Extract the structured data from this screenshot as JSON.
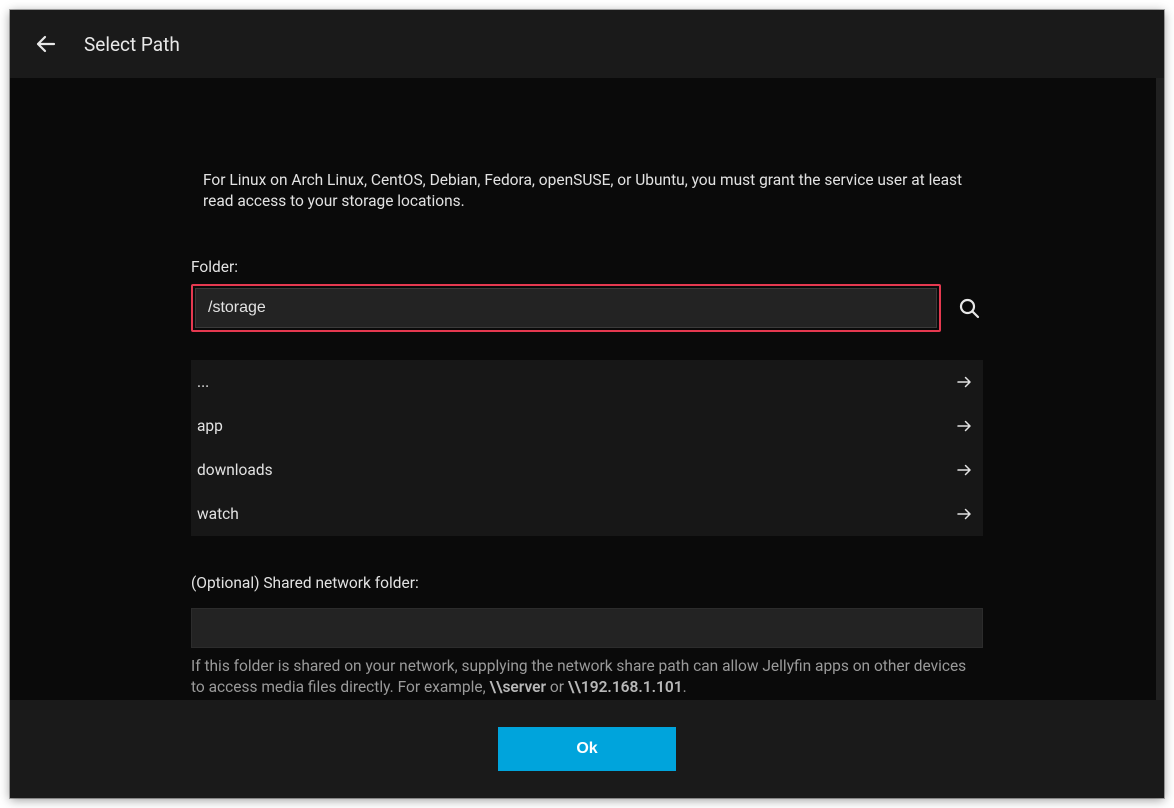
{
  "header": {
    "title": "Select Path"
  },
  "instruction": "For Linux on Arch Linux, CentOS, Debian, Fedora, openSUSE, or Ubuntu, you must grant the service user at least read access to your storage locations.",
  "folder": {
    "label": "Folder:",
    "value": "/storage"
  },
  "items": [
    {
      "name": "..."
    },
    {
      "name": "app"
    },
    {
      "name": "downloads"
    },
    {
      "name": "watch"
    }
  ],
  "network": {
    "label": "(Optional) Shared network folder:",
    "value": "",
    "help_prefix": "If this folder is shared on your network, supplying the network share path can allow Jellyfin apps on other devices to access media files directly. For example, ",
    "example1": "\\\\server",
    "or": " or ",
    "example2": "\\\\192.168.1.101",
    "suffix": "."
  },
  "footer": {
    "ok": "Ok"
  }
}
